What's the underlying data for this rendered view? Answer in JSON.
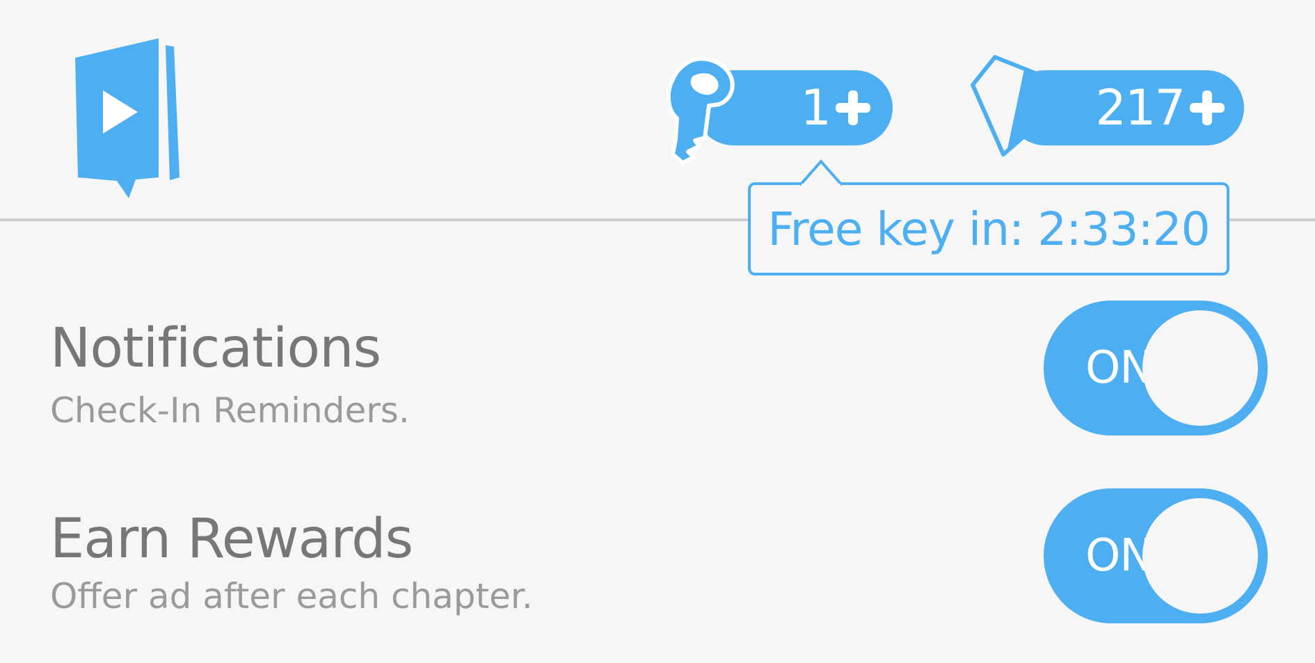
{
  "header": {
    "logo_icon": "book-play-icon",
    "keys": {
      "icon": "key-icon",
      "count": "1",
      "add_icon": "plus-icon"
    },
    "gems": {
      "icon": "gem-icon",
      "count": "217",
      "add_icon": "plus-icon"
    },
    "tooltip": {
      "text": "Free key in: 2:33:20"
    }
  },
  "settings": [
    {
      "title": "Notifications",
      "subtitle": "Check-In Reminders.",
      "toggle_label": "ON",
      "enabled": true
    },
    {
      "title": "Earn Rewards",
      "subtitle": "Offer ad after each chapter.",
      "toggle_label": "ON",
      "enabled": true
    }
  ],
  "colors": {
    "accent": "#4eaef2",
    "background": "#f6f6f6",
    "title_text": "#777777",
    "subtitle_text": "#9a9a9a",
    "divider": "#cfcfcf"
  }
}
